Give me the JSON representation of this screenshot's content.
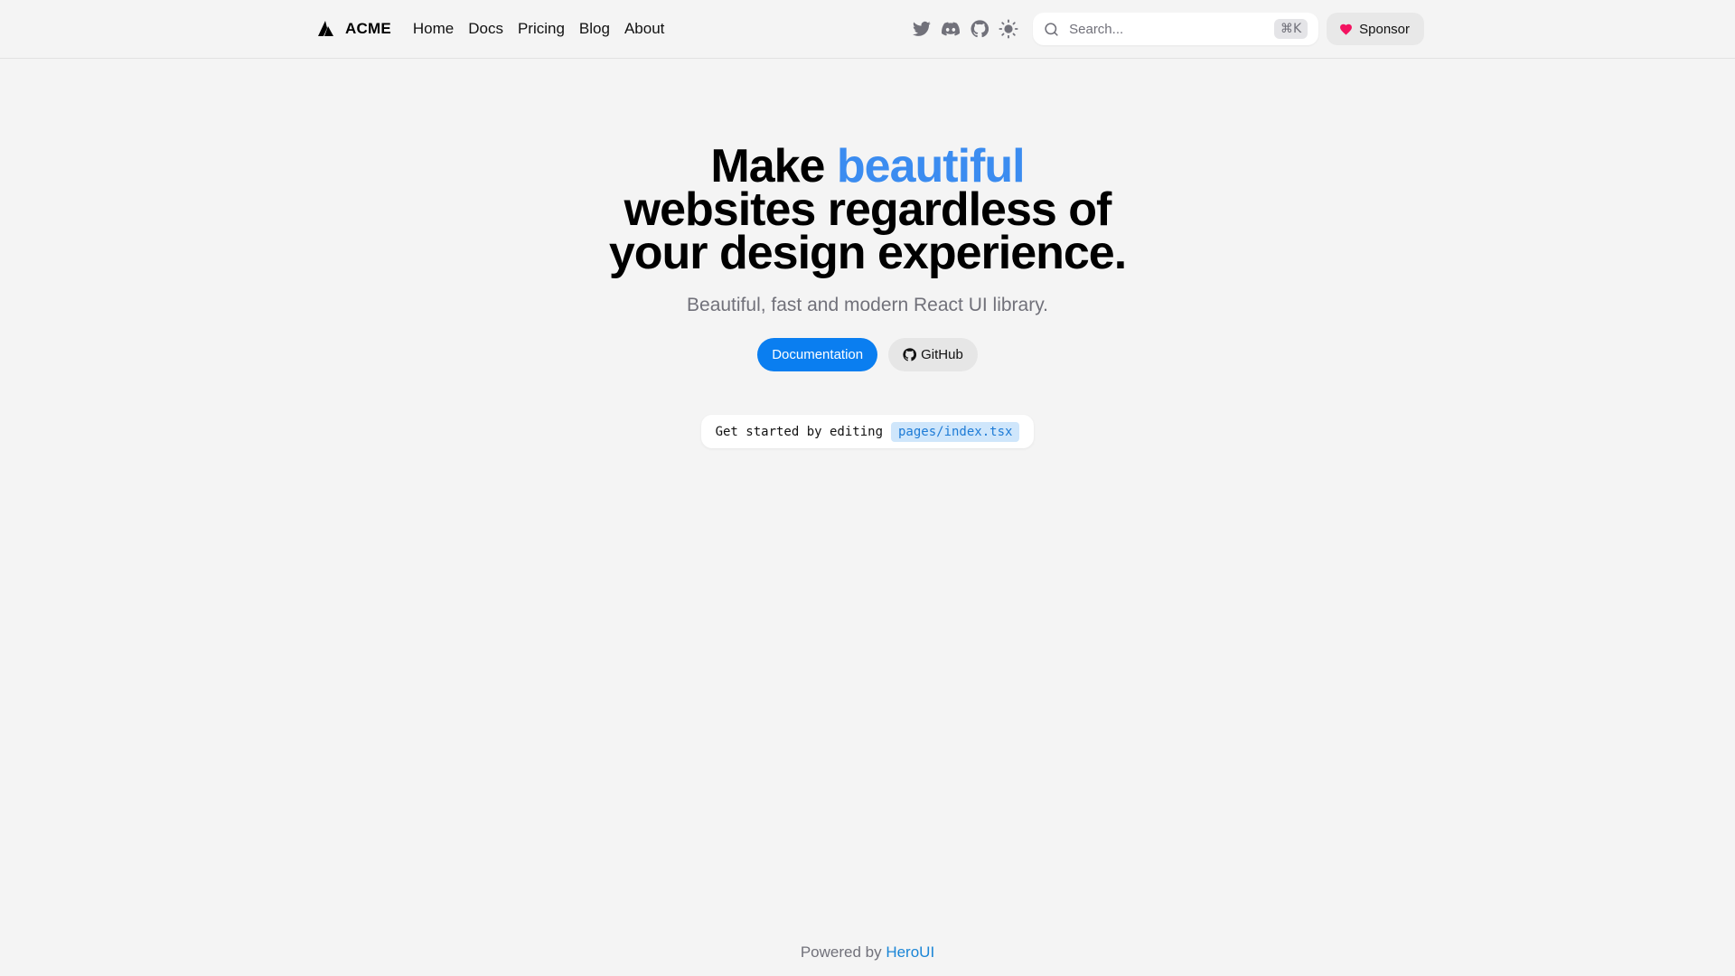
{
  "navbar": {
    "brand": {
      "name": "ACME",
      "logo_icon": "triangle-logo-icon"
    },
    "links": [
      {
        "label": "Home"
      },
      {
        "label": "Docs"
      },
      {
        "label": "Pricing"
      },
      {
        "label": "Blog"
      },
      {
        "label": "About"
      }
    ],
    "icons": [
      "twitter-icon",
      "discord-icon",
      "github-icon",
      "sun-icon"
    ],
    "search": {
      "placeholder": "Search...",
      "shortcut": "⌘K"
    },
    "sponsor_label": "Sponsor"
  },
  "hero": {
    "headline_start": "Make",
    "headline_accent": "beautiful",
    "headline_line2": "websites regardless of",
    "headline_line3": "your design experience.",
    "subtitle": "Beautiful, fast and modern React UI library.",
    "primary_button": "Documentation",
    "secondary_button": "GitHub",
    "snippet_text": "Get started by editing",
    "snippet_code": "pages/index.tsx"
  },
  "footer": {
    "prefix": "Powered by",
    "link": "HeroUI"
  },
  "colors": {
    "background": "#f4f4f4",
    "accent": "#3b8cf0",
    "primary": "#0a7ef0",
    "muted": "#71717a",
    "heart": "#f31260"
  }
}
